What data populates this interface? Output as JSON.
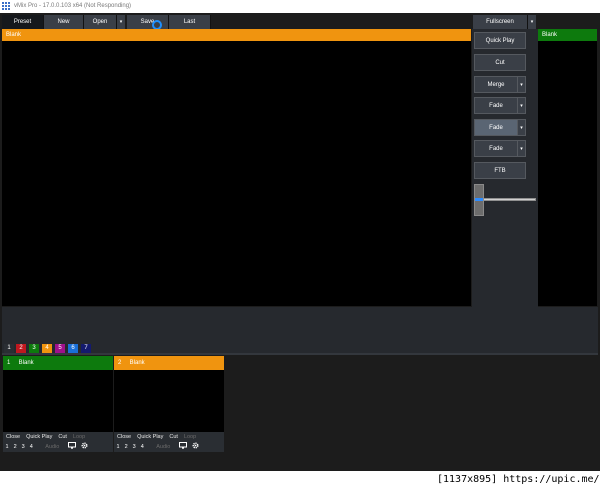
{
  "window": {
    "title": "vMix Pro - 17.0.0.103 x64 (Not Responding)"
  },
  "toolbar": {
    "preset": "Preset",
    "new": "New",
    "open": "Open",
    "save": "Save",
    "last": "Last",
    "fullscreen": "Fullscreen",
    "dropdown_glyph": "▾"
  },
  "preview": {
    "label": "Blank",
    "color": "#f0940f"
  },
  "output": {
    "label": "Blank",
    "color": "#0d7a0d"
  },
  "transitions": {
    "quick_play": "Quick Play",
    "cut": "Cut",
    "merge": "Merge",
    "fade1": "Fade",
    "fade2": "Fade",
    "fade3": "Fade",
    "ftb": "FTB"
  },
  "tabs": [
    {
      "label": "1",
      "color": "#2a2e33"
    },
    {
      "label": "2",
      "color": "#c0181f"
    },
    {
      "label": "3",
      "color": "#0d7a0d"
    },
    {
      "label": "4",
      "color": "#f0940f"
    },
    {
      "label": "5",
      "color": "#a0108c"
    },
    {
      "label": "6",
      "color": "#1a6fd8"
    },
    {
      "label": "7",
      "color": "#141a6e"
    }
  ],
  "inputs": [
    {
      "number": "1",
      "label": "Blank",
      "color": "#0d7a0d",
      "close": "Close",
      "quick_play": "Quick Play",
      "cut": "Cut",
      "loop": "Loop",
      "o1": "1",
      "o2": "2",
      "o3": "3",
      "o4": "4",
      "audio": "Audio"
    },
    {
      "number": "2",
      "label": "Blank",
      "color": "#f0940f",
      "close": "Close",
      "quick_play": "Quick Play",
      "cut": "Cut",
      "loop": "Loop",
      "o1": "1",
      "o2": "2",
      "o3": "3",
      "o4": "4",
      "audio": "Audio"
    }
  ],
  "icons": {
    "monitor": "monitor-icon",
    "gear": "gear-icon",
    "app": "vmix-app-icon",
    "cursor": "busy-cursor-icon"
  },
  "watermark": "[1137x895] https://upic.me/"
}
